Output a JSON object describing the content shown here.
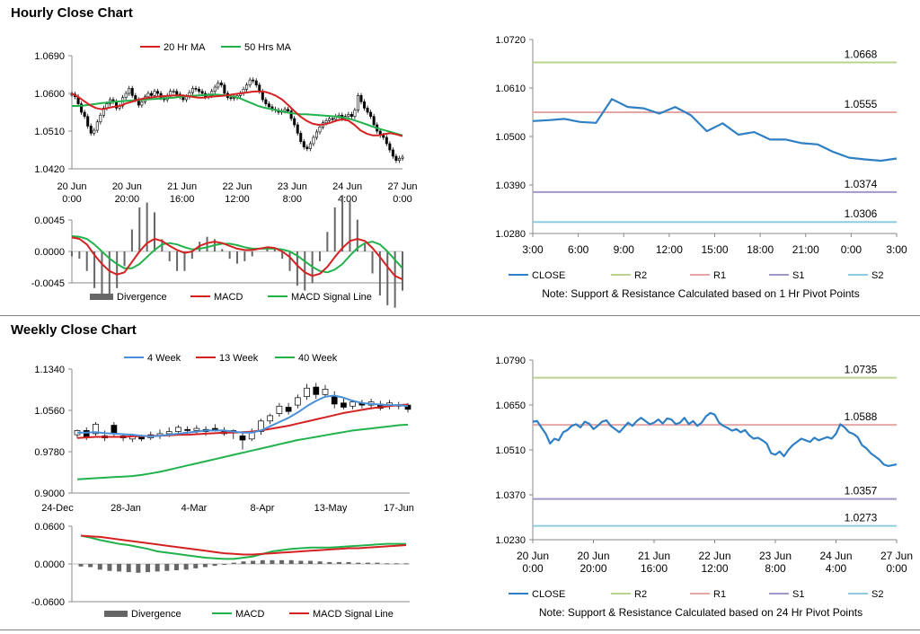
{
  "hourly_section": {
    "title": "Hourly Close Chart"
  },
  "weekly_section": {
    "title": "Weekly Close Chart"
  },
  "colors": {
    "ma_red": "#d42222",
    "ma_green": "#22b24c",
    "ma_blue": "#4a90d9",
    "close": "#2f7fc4",
    "r2": "#b9d38e",
    "r1": "#e6a6a6",
    "s1": "#a396c8",
    "s2": "#8fcbe0",
    "bar": "#666666"
  },
  "chart_data": [
    {
      "id": "hourly-price",
      "type": "candlestick",
      "ylim": [
        1.042,
        1.069
      ],
      "yticks": [
        "1.0690",
        "1.0600",
        "1.0510",
        "1.0420"
      ],
      "xticks": [
        [
          "20 Jun",
          "0:00"
        ],
        [
          "20 Jun",
          "20:00"
        ],
        [
          "21 Jun",
          "16:00"
        ],
        [
          "22 Jun",
          "12:00"
        ],
        [
          "23 Jun",
          "8:00"
        ],
        [
          "24 Jun",
          "4:00"
        ],
        [
          "27 Jun",
          "0:00"
        ]
      ],
      "legend": [
        "20 Hr MA",
        "50 Hrs MA"
      ],
      "close": [
        1.0598,
        1.0592,
        1.0575,
        1.0555,
        1.0545,
        1.0522,
        1.0505,
        1.0512,
        1.0532,
        1.0548,
        1.0565,
        1.0575,
        1.0585,
        1.058,
        1.0565,
        1.057,
        1.059,
        1.06,
        1.0612,
        1.0595,
        1.0585,
        1.0572,
        1.058,
        1.0592,
        1.06,
        1.0595,
        1.0605,
        1.06,
        1.059,
        1.0585,
        1.0595,
        1.0605,
        1.0605,
        1.0598,
        1.0592,
        1.0585,
        1.0592,
        1.0602,
        1.0612,
        1.061,
        1.0605,
        1.06,
        1.0592,
        1.0595,
        1.0605,
        1.0615,
        1.0625,
        1.062,
        1.06,
        1.059,
        1.0588,
        1.059,
        1.0595,
        1.06,
        1.061,
        1.062,
        1.0632,
        1.063,
        1.062,
        1.0605,
        1.0585,
        1.0575,
        1.0568,
        1.0562,
        1.056,
        1.0555,
        1.0558,
        1.0562,
        1.0558,
        1.054,
        1.0525,
        1.0505,
        1.0485,
        1.0472,
        1.0468,
        1.048,
        1.0495,
        1.0508,
        1.052,
        1.053,
        1.0535,
        1.054,
        1.0538,
        1.0545,
        1.0548,
        1.054,
        1.0545,
        1.055,
        1.0545,
        1.056,
        1.0595,
        1.058,
        1.0565,
        1.0555,
        1.0545,
        1.0525,
        1.051,
        1.05,
        1.0495,
        1.048,
        1.0465,
        1.045,
        1.044,
        1.0445,
        1.0448
      ],
      "ma20": [
        1.06,
        1.0592,
        1.0582,
        1.0572,
        1.0565,
        1.0562,
        1.0565,
        1.0568,
        1.057,
        1.0576,
        1.058,
        1.0585,
        1.0588,
        1.059,
        1.0592,
        1.0593,
        1.0594,
        1.0595,
        1.0595,
        1.0594,
        1.0592,
        1.059,
        1.059,
        1.0592,
        1.0593,
        1.0594,
        1.0596,
        1.0598,
        1.06,
        1.0602,
        1.0604,
        1.0605,
        1.0604,
        1.06,
        1.0594,
        1.0585,
        1.0572,
        1.0558,
        1.0545,
        1.0535,
        1.0528,
        1.0525,
        1.0526,
        1.053,
        1.0535,
        1.0538,
        1.0535,
        1.0525,
        1.0512,
        1.0504,
        1.05,
        1.05,
        1.0503,
        1.0505,
        1.0502,
        1.0498
      ],
      "ma50": [
        1.057,
        1.057,
        1.0571,
        1.0573,
        1.0575,
        1.0577,
        1.0578,
        1.058,
        1.0581,
        1.0582,
        1.0583,
        1.0584,
        1.0585,
        1.0586,
        1.0587,
        1.0588,
        1.0589,
        1.059,
        1.0592,
        1.0593,
        1.0594,
        1.0595,
        1.0596,
        1.0597,
        1.0597,
        1.0596,
        1.0595,
        1.0592,
        1.0588,
        1.0582,
        1.0576,
        1.057,
        1.0566,
        1.0563,
        1.056,
        1.0557,
        1.0554,
        1.0552,
        1.055,
        1.055,
        1.0549,
        1.0548,
        1.0547,
        1.0546,
        1.0545,
        1.0543,
        1.054,
        1.0536,
        1.0531,
        1.0526,
        1.0521,
        1.0516,
        1.0512,
        1.0508,
        1.0504,
        1.05
      ]
    },
    {
      "id": "hourly-macd",
      "type": "macd",
      "ylim": [
        -0.0045,
        0.0045
      ],
      "yticks": [
        "0.0045",
        "0.0000",
        "-0.0045"
      ],
      "legend": [
        "Divergence",
        "MACD",
        "MACD Signal Line"
      ],
      "macd": [
        0.002,
        0.0018,
        0.001,
        -0.0005,
        -0.0018,
        -0.0028,
        -0.0033,
        -0.003,
        -0.0015,
        0.0,
        0.0012,
        0.0018,
        0.0015,
        0.0008,
        0.0002,
        -0.0002,
        0.0,
        0.0008,
        0.0012,
        0.0014,
        0.0012,
        0.0008,
        0.0004,
        0.0002,
        0.0002,
        0.0004,
        0.0006,
        0.0005,
        0.0,
        -0.0008,
        -0.002,
        -0.003,
        -0.0035,
        -0.0032,
        -0.0022,
        -0.0008,
        0.0005,
        0.0015,
        0.0018,
        0.0015,
        0.0005,
        -0.0008,
        -0.0022,
        -0.0035,
        -0.004
      ],
      "signal": [
        0.0022,
        0.0021,
        0.0018,
        0.001,
        0.0,
        -0.001,
        -0.0018,
        -0.0024,
        -0.0024,
        -0.0018,
        -0.0008,
        0.0002,
        0.001,
        0.0012,
        0.001,
        0.0006,
        0.0003,
        0.0004,
        0.0006,
        0.0009,
        0.0011,
        0.0011,
        0.0009,
        0.0006,
        0.0004,
        0.0004,
        0.0004,
        0.0004,
        0.0003,
        0.0,
        -0.0006,
        -0.0014,
        -0.0022,
        -0.0028,
        -0.003,
        -0.0026,
        -0.0018,
        -0.0006,
        0.0005,
        0.0012,
        0.0014,
        0.001,
        0.0,
        -0.0012,
        -0.0024
      ]
    },
    {
      "id": "hourly-pivot",
      "type": "line",
      "ylim": [
        1.028,
        1.072
      ],
      "yticks": [
        "1.0720",
        "1.0610",
        "1.0500",
        "1.0390",
        "1.0280"
      ],
      "categories": [
        "3:00",
        "6:00",
        "9:00",
        "12:00",
        "15:00",
        "18:00",
        "21:00",
        "0:00",
        "3:00"
      ],
      "series": [
        {
          "name": "CLOSE",
          "values": [
            1.0535,
            1.0537,
            1.054,
            1.0533,
            1.0531,
            1.0585,
            1.0567,
            1.0564,
            1.0552,
            1.0567,
            1.0548,
            1.0512,
            1.053,
            1.0504,
            1.051,
            1.0493,
            1.0493,
            1.0485,
            1.0482,
            1.0465,
            1.0452,
            1.0448,
            1.0445,
            1.045
          ]
        }
      ],
      "levels": [
        {
          "name": "R2",
          "value": 1.0668,
          "label": "1.0668"
        },
        {
          "name": "R1",
          "value": 1.0555,
          "label": "1.0555"
        },
        {
          "name": "S1",
          "value": 1.0374,
          "label": "1.0374"
        },
        {
          "name": "S2",
          "value": 1.0306,
          "label": "1.0306"
        }
      ],
      "legend": [
        "CLOSE",
        "R2",
        "R1",
        "S1",
        "S2"
      ],
      "note": "Note: Support & Resistance Calculated based on 1 Hr Pivot Points"
    },
    {
      "id": "weekly-price",
      "type": "candlestick",
      "ylim": [
        0.9,
        1.134
      ],
      "yticks": [
        "1.1340",
        "1.0560",
        "0.9780",
        "0.9000"
      ],
      "xticks": [
        "24-Dec",
        "28-Jan",
        "4-Mar",
        "8-Apr",
        "13-May",
        "17-Jun"
      ],
      "legend": [
        "4 Week",
        "13 Week",
        "40 Week"
      ],
      "candles": [
        [
          1.01,
          1.018,
          1.004,
          1.02
        ],
        [
          1.018,
          1.006,
          1.0,
          1.024
        ],
        [
          1.012,
          1.03,
          1.008,
          1.034
        ],
        [
          1.008,
          1.004,
          0.998,
          1.018
        ],
        [
          1.028,
          1.012,
          1.006,
          1.034
        ],
        [
          1.008,
          1.004,
          0.998,
          1.012
        ],
        [
          1.002,
          1.008,
          0.996,
          1.012
        ],
        [
          1.006,
          1.002,
          0.998,
          1.01
        ],
        [
          1.004,
          1.01,
          1.0,
          1.016
        ],
        [
          1.008,
          1.012,
          1.002,
          1.02
        ],
        [
          1.012,
          1.016,
          1.006,
          1.024
        ],
        [
          1.016,
          1.024,
          1.01,
          1.028
        ],
        [
          1.02,
          1.018,
          1.012,
          1.026
        ],
        [
          1.018,
          1.022,
          1.012,
          1.028
        ],
        [
          1.02,
          1.016,
          1.008,
          1.026
        ],
        [
          1.022,
          1.02,
          1.016,
          1.03
        ],
        [
          1.018,
          1.012,
          1.008,
          1.024
        ],
        [
          1.014,
          1.018,
          1.002,
          1.02
        ],
        [
          1.008,
          1.0,
          0.982,
          1.016
        ],
        [
          1.002,
          1.016,
          0.998,
          1.022
        ],
        [
          1.016,
          1.036,
          1.01,
          1.04
        ],
        [
          1.036,
          1.046,
          1.03,
          1.05
        ],
        [
          1.05,
          1.064,
          1.044,
          1.07
        ],
        [
          1.062,
          1.054,
          1.048,
          1.07
        ],
        [
          1.066,
          1.08,
          1.06,
          1.086
        ],
        [
          1.082,
          1.098,
          1.076,
          1.106
        ],
        [
          1.1,
          1.086,
          1.078,
          1.108
        ],
        [
          1.086,
          1.096,
          1.08,
          1.104
        ],
        [
          1.082,
          1.068,
          1.06,
          1.092
        ],
        [
          1.07,
          1.062,
          1.058,
          1.078
        ],
        [
          1.064,
          1.072,
          1.058,
          1.076
        ],
        [
          1.07,
          1.066,
          1.06,
          1.076
        ],
        [
          1.066,
          1.072,
          1.058,
          1.078
        ],
        [
          1.068,
          1.06,
          1.056,
          1.074
        ],
        [
          1.064,
          1.07,
          1.058,
          1.076
        ],
        [
          1.066,
          1.064,
          1.058,
          1.072
        ],
        [
          1.066,
          1.058,
          1.052,
          1.07
        ]
      ],
      "w4": [
        1.014,
        1.014,
        1.015,
        1.013,
        1.012,
        1.011,
        1.01,
        1.008,
        1.007,
        1.008,
        1.01,
        1.012,
        1.014,
        1.016,
        1.018,
        1.018,
        1.018,
        1.016,
        1.014,
        1.014,
        1.018,
        1.026,
        1.034,
        1.042,
        1.052,
        1.064,
        1.074,
        1.082,
        1.084,
        1.08,
        1.074,
        1.07,
        1.068,
        1.067,
        1.066,
        1.066,
        1.064
      ],
      "w13": [
        1.004,
        1.005,
        1.006,
        1.006,
        1.006,
        1.006,
        1.007,
        1.007,
        1.008,
        1.008,
        1.009,
        1.01,
        1.01,
        1.011,
        1.012,
        1.013,
        1.014,
        1.014,
        1.015,
        1.016,
        1.018,
        1.021,
        1.024,
        1.027,
        1.031,
        1.035,
        1.039,
        1.043,
        1.047,
        1.051,
        1.054,
        1.057,
        1.06,
        1.062,
        1.064,
        1.066,
        1.067
      ],
      "w40": [
        0.926,
        0.927,
        0.928,
        0.929,
        0.93,
        0.931,
        0.932,
        0.934,
        0.937,
        0.94,
        0.944,
        0.948,
        0.952,
        0.956,
        0.96,
        0.964,
        0.968,
        0.972,
        0.976,
        0.98,
        0.984,
        0.988,
        0.992,
        0.996,
        1.0,
        1.003,
        1.006,
        1.009,
        1.012,
        1.015,
        1.018,
        1.02,
        1.022,
        1.024,
        1.026,
        1.028,
        1.029
      ]
    },
    {
      "id": "weekly-macd",
      "type": "macd",
      "ylim": [
        -0.06,
        0.06
      ],
      "yticks": [
        "0.0600",
        "0.0000",
        "-0.0600"
      ],
      "legend": [
        "Divergence",
        "MACD",
        "MACD Signal Line"
      ],
      "macd": [
        0.045,
        0.042,
        0.038,
        0.035,
        0.032,
        0.03,
        0.027,
        0.024,
        0.02,
        0.018,
        0.016,
        0.014,
        0.012,
        0.01,
        0.009,
        0.008,
        0.008,
        0.01,
        0.012,
        0.016,
        0.02,
        0.022,
        0.024,
        0.025,
        0.026,
        0.026,
        0.026,
        0.027,
        0.028,
        0.029,
        0.03,
        0.031,
        0.032,
        0.032,
        0.032
      ],
      "signal": [
        0.045,
        0.044,
        0.043,
        0.041,
        0.039,
        0.037,
        0.035,
        0.033,
        0.031,
        0.029,
        0.027,
        0.025,
        0.023,
        0.021,
        0.019,
        0.017,
        0.016,
        0.015,
        0.015,
        0.016,
        0.017,
        0.018,
        0.019,
        0.02,
        0.021,
        0.022,
        0.023,
        0.024,
        0.025,
        0.025,
        0.026,
        0.027,
        0.028,
        0.029,
        0.03
      ],
      "divergence": [
        -0.004,
        -0.005,
        -0.009,
        -0.011,
        -0.012,
        -0.013,
        -0.014,
        -0.013,
        -0.012,
        -0.011,
        -0.01,
        -0.009,
        -0.007,
        -0.005,
        -0.003,
        -0.001,
        0.002,
        0.004,
        0.005,
        0.006,
        0.006,
        0.006,
        0.006,
        0.005,
        0.005,
        0.004,
        0.003,
        0.003,
        0.003,
        0.002,
        0.002,
        0.002,
        0.001,
        0.001,
        0.001
      ]
    },
    {
      "id": "weekly-pivot",
      "type": "line",
      "ylim": [
        1.023,
        1.079
      ],
      "yticks": [
        "1.0790",
        "1.0650",
        "1.0510",
        "1.0370",
        "1.0230"
      ],
      "xticks": [
        [
          "20 Jun",
          "0:00"
        ],
        [
          "20 Jun",
          "20:00"
        ],
        [
          "21 Jun",
          "16:00"
        ],
        [
          "22 Jun",
          "12:00"
        ],
        [
          "23 Jun",
          "8:00"
        ],
        [
          "24 Jun",
          "4:00"
        ],
        [
          "27 Jun",
          "0:00"
        ]
      ],
      "series": [
        {
          "name": "CLOSE",
          "values": [
            1.0598,
            1.06,
            1.058,
            1.056,
            1.053,
            1.0545,
            1.054,
            1.0565,
            1.0572,
            1.0585,
            1.059,
            1.058,
            1.0598,
            1.0592,
            1.0575,
            1.0585,
            1.0598,
            1.0602,
            1.0585,
            1.0575,
            1.0565,
            1.058,
            1.0595,
            1.0585,
            1.06,
            1.061,
            1.06,
            1.059,
            1.0595,
            1.0605,
            1.0592,
            1.0608,
            1.0605,
            1.059,
            1.0595,
            1.061,
            1.059,
            1.06,
            1.0585,
            1.0595,
            1.0615,
            1.0625,
            1.062,
            1.0595,
            1.0585,
            1.0578,
            1.057,
            1.0575,
            1.0565,
            1.0572,
            1.0555,
            1.0545,
            1.0548,
            1.054,
            1.053,
            1.05,
            1.0495,
            1.0505,
            1.049,
            1.051,
            1.0525,
            1.0535,
            1.0545,
            1.054,
            1.0535,
            1.0548,
            1.054,
            1.0545,
            1.055,
            1.0545,
            1.056,
            1.059,
            1.058,
            1.0565,
            1.056,
            1.055,
            1.0525,
            1.0515,
            1.05,
            1.049,
            1.048,
            1.0465,
            1.046,
            1.0462,
            1.0465
          ]
        }
      ],
      "levels": [
        {
          "name": "R2",
          "value": 1.0735,
          "label": "1.0735"
        },
        {
          "name": "R1",
          "value": 1.0588,
          "label": "1.0588"
        },
        {
          "name": "S1",
          "value": 1.0357,
          "label": "1.0357"
        },
        {
          "name": "S2",
          "value": 1.0273,
          "label": "1.0273"
        }
      ],
      "legend": [
        "CLOSE",
        "R2",
        "R1",
        "S1",
        "S2"
      ],
      "note": "Note: Support & Resistance Calculated based on 24 Hr Pivot Points"
    }
  ]
}
